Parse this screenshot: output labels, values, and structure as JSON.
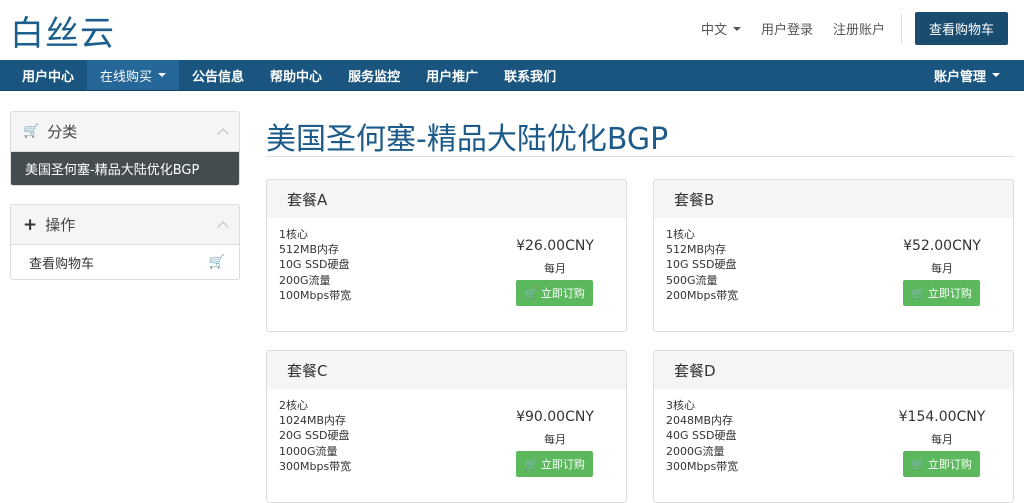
{
  "brand": {
    "logo": "白丝云"
  },
  "top_links": {
    "language": "中文",
    "login": "用户登录",
    "register": "注册账户",
    "cart_button": "查看购物车"
  },
  "nav": {
    "items": [
      "用户中心",
      "在线购买",
      "公告信息",
      "帮助中心",
      "服务监控",
      "用户推广",
      "联系我们"
    ],
    "active_index": 1,
    "right": "账户管理"
  },
  "sidebar": {
    "categories": {
      "title": "分类",
      "items": [
        "美国圣何塞-精品大陆优化BGP"
      ]
    },
    "actions": {
      "title": "操作",
      "items": [
        "查看购物车"
      ]
    }
  },
  "page": {
    "title": "美国圣何塞-精品大陆优化BGP"
  },
  "plans": [
    {
      "name": "套餐A",
      "specs": [
        "1核心",
        "512MB内存",
        "10G SSD硬盘",
        "200G流量",
        "100Mbps带宽"
      ],
      "price": "¥26.00CNY",
      "period": "每月",
      "button": "立即订购"
    },
    {
      "name": "套餐B",
      "specs": [
        "1核心",
        "512MB内存",
        "10G SSD硬盘",
        "500G流量",
        "200Mbps带宽"
      ],
      "price": "¥52.00CNY",
      "period": "每月",
      "button": "立即订购"
    },
    {
      "name": "套餐C",
      "specs": [
        "2核心",
        "1024MB内存",
        "20G SSD硬盘",
        "1000G流量",
        "300Mbps带宽"
      ],
      "price": "¥90.00CNY",
      "period": "每月",
      "button": "立即订购"
    },
    {
      "name": "套餐D",
      "specs": [
        "3核心",
        "2048MB内存",
        "40G SSD硬盘",
        "2000G流量",
        "300Mbps带宽"
      ],
      "price": "¥154.00CNY",
      "period": "每月",
      "button": "立即订购"
    }
  ],
  "colors": {
    "brand": "#1d5f8c",
    "navbar": "#1a5580",
    "cart_button": "#1a4c70",
    "order_button": "#5cb85c",
    "sidebar_active": "#444c50"
  },
  "icons": {
    "cart": "shopping-cart-icon",
    "plus": "plus-icon",
    "collapse": "chevron-up-icon"
  }
}
